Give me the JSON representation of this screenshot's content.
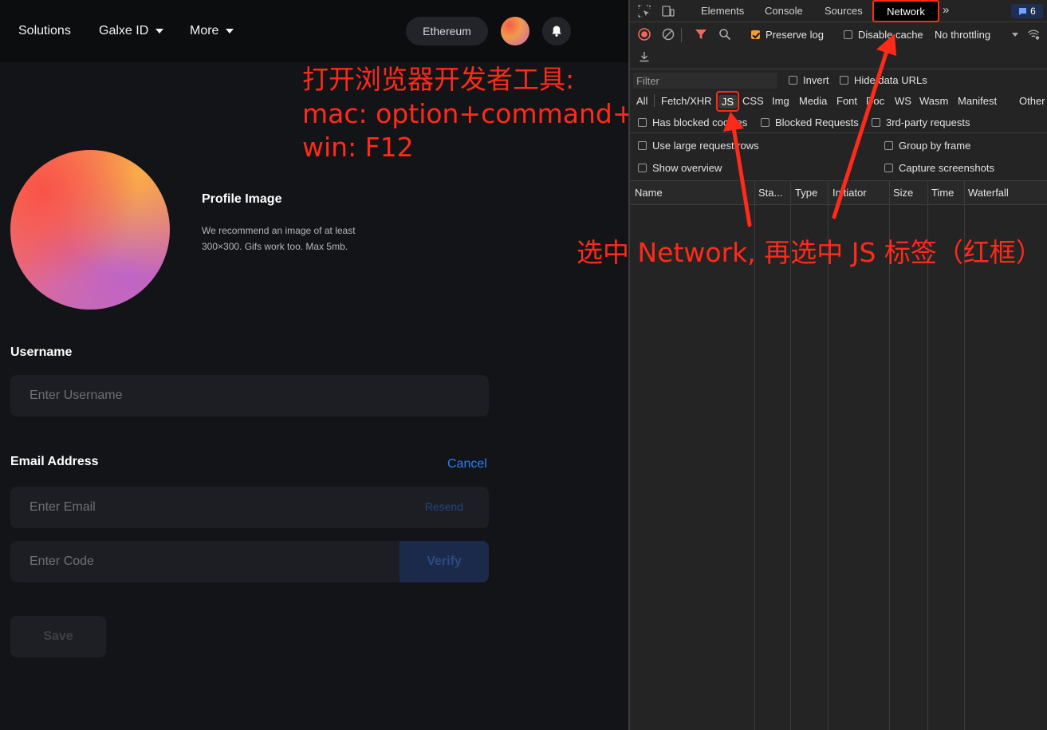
{
  "nav": {
    "solutions": "Solutions",
    "galxe_id": "Galxe ID",
    "more": "More",
    "network": "Ethereum"
  },
  "profile": {
    "title": "Profile Image",
    "description": "We recommend an image of at least 300×300. Gifs work too. Max 5mb."
  },
  "username": {
    "label": "Username",
    "placeholder": "Enter Username"
  },
  "email": {
    "label": "Email Address",
    "cancel": "Cancel",
    "placeholder": "Enter Email",
    "resend": "Resend",
    "code_placeholder": "Enter Code",
    "verify": "Verify"
  },
  "save": "Save",
  "annotations": {
    "top_line1": "打开浏览器开发者工具:",
    "top_line2": "mac: option+command+i",
    "top_line3": "win: F12",
    "middle": "选中 Network, 再选中 JS 标签（红框）"
  },
  "devtools": {
    "tabs": [
      "Elements",
      "Console",
      "Sources",
      "Network"
    ],
    "more_tabs": "»",
    "badge_count": "6",
    "toolbar": {
      "preserve_log": "Preserve log",
      "disable_cache": "Disable cache",
      "throttling": "No throttling"
    },
    "filter": {
      "placeholder": "Filter",
      "invert": "Invert",
      "hide_data_urls": "Hide data URLs"
    },
    "types": [
      "All",
      "Fetch/XHR",
      "JS",
      "CSS",
      "Img",
      "Media",
      "Font",
      "Doc",
      "WS",
      "Wasm",
      "Manifest",
      "Other"
    ],
    "options": {
      "blocked_cookies": "Has blocked cookies",
      "blocked_requests": "Blocked Requests",
      "third_party": "3rd-party requests",
      "large_rows": "Use large request rows",
      "group_by_frame": "Group by frame",
      "show_overview": "Show overview",
      "capture_screenshots": "Capture screenshots"
    },
    "columns": [
      "Name",
      "Sta...",
      "Type",
      "Initiator",
      "Size",
      "Time",
      "Waterfall"
    ]
  },
  "colors": {
    "accent": "#2a7fff",
    "annotation": "#ff2a1a",
    "preserve_checked": "#f59b34"
  }
}
